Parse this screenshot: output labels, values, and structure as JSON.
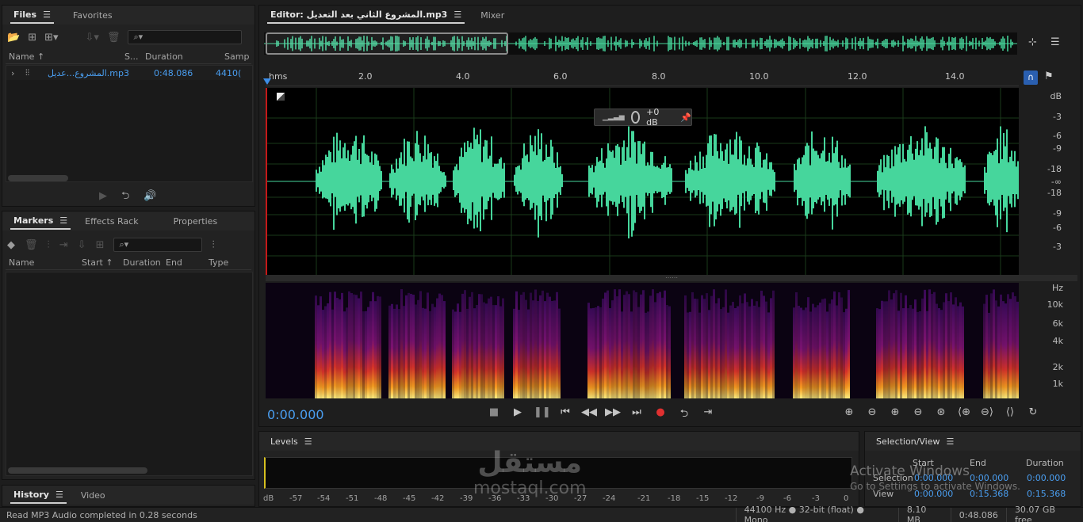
{
  "files": {
    "tabs": [
      {
        "label": "Files",
        "active": true
      },
      {
        "label": "Favorites",
        "active": false
      }
    ],
    "columns": [
      "Name ↑",
      "S...",
      "Duration",
      "Sampl"
    ],
    "rows": [
      {
        "expand": "›",
        "name": "المشروع...عديل.mp3",
        "duration": "0:48.086",
        "sample": "4410("
      }
    ]
  },
  "markers": {
    "tabs": [
      {
        "label": "Markers",
        "active": true
      },
      {
        "label": "Effects Rack",
        "active": false
      },
      {
        "label": "Properties",
        "active": false
      }
    ],
    "columns": [
      "Name",
      "Start ↑",
      "Duration",
      "End",
      "Type"
    ]
  },
  "history": {
    "tabs": [
      {
        "label": "History",
        "active": true
      },
      {
        "label": "Video",
        "active": false
      }
    ]
  },
  "editor": {
    "tabs": [
      {
        "label": "Editor: المشروع الثاني بعد التعديل.mp3",
        "active": true
      },
      {
        "label": "Mixer",
        "active": false
      }
    ],
    "ruler_unit": "hms",
    "ruler_ticks": [
      "2.0",
      "4.0",
      "6.0",
      "8.0",
      "10.0",
      "12.0",
      "14.0"
    ],
    "db_scale": [
      "dB",
      "-3",
      "-6",
      "-9",
      "-18",
      "-∞",
      "-18",
      "-9",
      "-6",
      "-3"
    ],
    "hz_scale": [
      "Hz",
      "10k",
      "6k",
      "4k",
      "2k",
      "1k"
    ],
    "hud_gain": "+0 dB",
    "time_display": "0:00.000",
    "waveform_color": "#46d69c"
  },
  "levels": {
    "title": "Levels",
    "scale": [
      "dB",
      "-57",
      "-54",
      "-51",
      "-48",
      "-45",
      "-42",
      "-39",
      "-36",
      "-33",
      "-30",
      "-27",
      "-24",
      "-21",
      "-18",
      "-15",
      "-12",
      "-9",
      "-6",
      "-3",
      "0"
    ]
  },
  "selection_view": {
    "title": "Selection/View",
    "headers": [
      "Start",
      "End",
      "Duration"
    ],
    "rows": [
      {
        "label": "Selection",
        "start": "0:00.000",
        "end": "0:00.000",
        "duration": "0:00.000"
      },
      {
        "label": "View",
        "start": "0:00.000",
        "end": "0:15.368",
        "duration": "0:15.368"
      }
    ]
  },
  "watermark": {
    "line1": "Activate Windows",
    "line2": "Go to Settings to activate Windows.",
    "logo": "مستقل",
    "logo_sub": "mostaql.com"
  },
  "status": {
    "message": "Read MP3 Audio completed in 0.28 seconds",
    "format": "44100 Hz ● 32-bit (float) ● Mono",
    "size": "8.10 MB",
    "duration": "0:48.086",
    "free": "30.07 GB free"
  }
}
